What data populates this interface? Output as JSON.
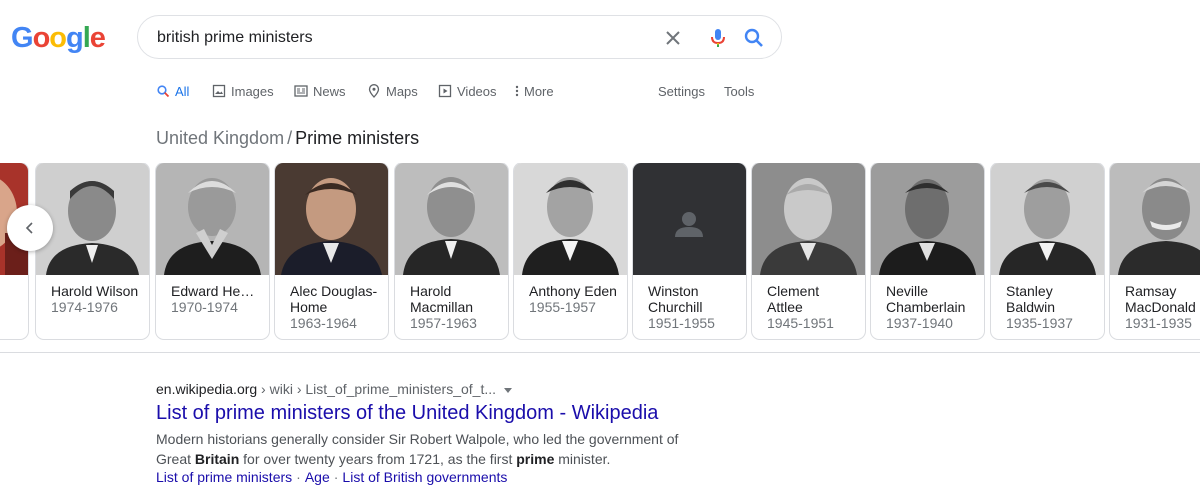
{
  "logo": {
    "text": "Google",
    "letters": [
      {
        "ch": "G",
        "color": "#4285F4"
      },
      {
        "ch": "o",
        "color": "#EA4335"
      },
      {
        "ch": "o",
        "color": "#FBBC05"
      },
      {
        "ch": "g",
        "color": "#4285F4"
      },
      {
        "ch": "l",
        "color": "#34A853"
      },
      {
        "ch": "e",
        "color": "#EA4335"
      }
    ]
  },
  "search": {
    "query": "british prime ministers"
  },
  "tabs": {
    "all": "All",
    "images": "Images",
    "news": "News",
    "maps": "Maps",
    "videos": "Videos",
    "more": "More",
    "settings": "Settings",
    "tools": "Tools"
  },
  "breadcrumb": {
    "parent": "United Kingdom",
    "separator": "/",
    "current": "Prime ministers"
  },
  "ministers": [
    {
      "name": "Harold Wilson",
      "years": "1974-1976"
    },
    {
      "name": "Edward He…",
      "years": "1970-1974"
    },
    {
      "name": "Alec Douglas-Home",
      "years": "1963-1964"
    },
    {
      "name": "Harold Macmillan",
      "years": "1957-1963"
    },
    {
      "name": "Anthony Eden",
      "years": "1955-1957"
    },
    {
      "name": "Winston Churchill",
      "years": "1951-1955"
    },
    {
      "name": "Clement Attlee",
      "years": "1945-1951"
    },
    {
      "name": "Neville Chamberlain",
      "years": "1937-1940"
    },
    {
      "name": "Stanley Baldwin",
      "years": "1935-1937"
    },
    {
      "name": "Ramsay MacDonald",
      "years": "1931-1935"
    }
  ],
  "result": {
    "domain": "en.wikipedia.org",
    "path": " › wiki › List_of_prime_ministers_of_t...",
    "title": "List of prime ministers of the United Kingdom - Wikipedia",
    "snippet_1": "Modern historians generally consider Sir Robert Walpole, who led the government of Great",
    "snippet_bold_1": "Britain",
    "snippet_2": " for over twenty years from 1721, as the first ",
    "snippet_bold_2": "prime",
    "snippet_3": " minister.",
    "sitelinks": [
      "List of prime ministers",
      "Age",
      "List of British governments"
    ],
    "sitelink_separator": "·"
  },
  "colors": {
    "link": "#1a0dab",
    "accent": "#1a73e8",
    "muted": "#70757a"
  },
  "icons": [
    "close-icon",
    "microphone-icon",
    "search-icon",
    "images-icon",
    "news-icon",
    "maps-icon",
    "videos-icon",
    "more-icon",
    "chevron-left-icon",
    "person-placeholder-icon"
  ]
}
